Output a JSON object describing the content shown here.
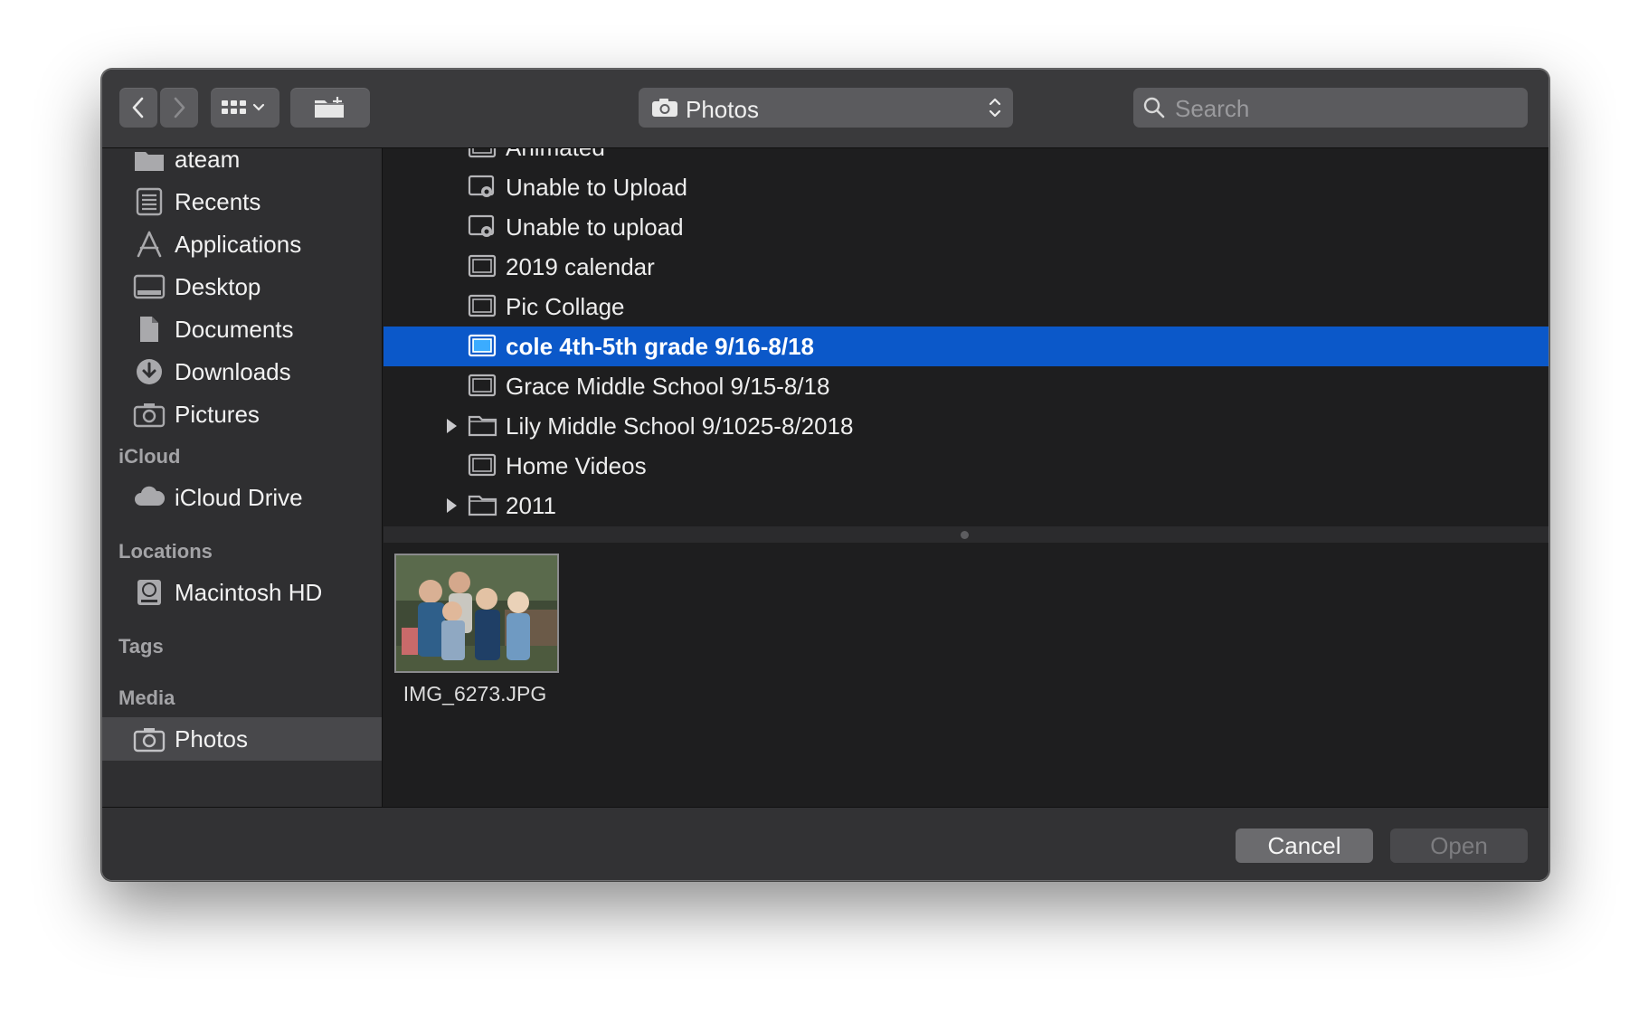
{
  "toolbar": {
    "back_icon": "chevron-left-icon",
    "forward_icon": "chevron-right-icon",
    "view_icon": "grid-view-icon",
    "new_folder_icon": "new-folder-icon",
    "location": "Photos",
    "search_placeholder": "Search"
  },
  "sidebar": {
    "items_top": [
      {
        "label": "ateam",
        "icon": "folder-icon"
      },
      {
        "label": "Recents",
        "icon": "recents-icon"
      },
      {
        "label": "Applications",
        "icon": "applications-icon"
      },
      {
        "label": "Desktop",
        "icon": "desktop-icon"
      },
      {
        "label": "Documents",
        "icon": "documents-icon"
      },
      {
        "label": "Downloads",
        "icon": "downloads-icon"
      },
      {
        "label": "Pictures",
        "icon": "camera-icon"
      }
    ],
    "icloud_header": "iCloud",
    "icloud_items": [
      {
        "label": "iCloud Drive",
        "icon": "cloud-icon"
      }
    ],
    "locations_header": "Locations",
    "locations_items": [
      {
        "label": "Macintosh HD",
        "icon": "hard-drive-icon"
      }
    ],
    "tags_header": "Tags",
    "media_header": "Media",
    "media_items": [
      {
        "label": "Photos",
        "icon": "camera-icon",
        "selected": true
      }
    ]
  },
  "files": [
    {
      "name": "Animated",
      "kind": "album-icon",
      "expandable": false,
      "selected": false
    },
    {
      "name": "Unable to Upload",
      "kind": "smart-album-icon",
      "expandable": false,
      "selected": false
    },
    {
      "name": "Unable to upload",
      "kind": "smart-album-icon",
      "expandable": false,
      "selected": false
    },
    {
      "name": "2019 calendar",
      "kind": "album-icon",
      "expandable": false,
      "selected": false
    },
    {
      "name": "Pic Collage",
      "kind": "album-icon",
      "expandable": false,
      "selected": false
    },
    {
      "name": "cole 4th-5th grade 9/16-8/18",
      "kind": "album-icon",
      "expandable": false,
      "selected": true
    },
    {
      "name": "Grace Middle School 9/15-8/18",
      "kind": "album-icon",
      "expandable": false,
      "selected": false
    },
    {
      "name": "Lily Middle School 9/1025-8/2018",
      "kind": "folder-icon",
      "expandable": true,
      "selected": false
    },
    {
      "name": "Home Videos",
      "kind": "album-icon",
      "expandable": false,
      "selected": false
    },
    {
      "name": "2011",
      "kind": "folder-icon",
      "expandable": true,
      "selected": false
    }
  ],
  "preview": {
    "filename": "IMG_6273.JPG"
  },
  "footer": {
    "cancel_label": "Cancel",
    "open_label": "Open"
  },
  "colors": {
    "selection": "#0b58c9",
    "sidebar_bg": "#2f2f31",
    "window_bg": "#1e1e1f"
  }
}
